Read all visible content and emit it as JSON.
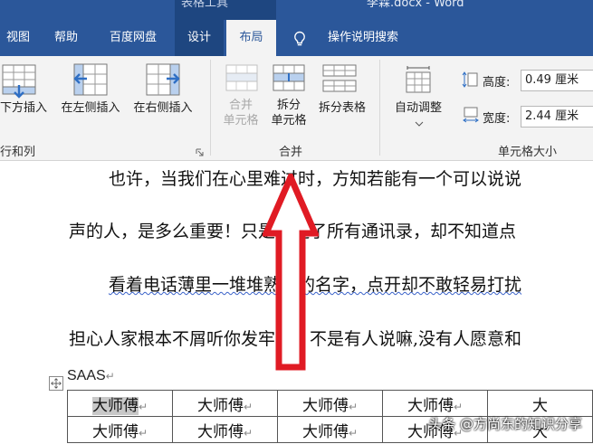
{
  "titlebar": {
    "tools_label": "表格工具",
    "document_title": "李霖.docx - Word"
  },
  "tabs": [
    {
      "label": "视图"
    },
    {
      "label": "帮助"
    },
    {
      "label": "百度网盘"
    },
    {
      "label": "设计"
    },
    {
      "label": "布局"
    },
    {
      "label": "操作说明搜索"
    }
  ],
  "ribbon": {
    "rows_cols": {
      "insert_below": "下方插入",
      "insert_left": "在左侧插入",
      "insert_right": "在右侧插入",
      "group_label": "行和列"
    },
    "merge": {
      "merge_cells_1": "合并",
      "merge_cells_2": "单元格",
      "split_cells_1": "拆分",
      "split_cells_2": "单元格",
      "split_table": "拆分表格",
      "group_label": "合并"
    },
    "cell_size": {
      "autofit": "自动调整",
      "height_label": "高度:",
      "height_value": "0.49 厘米",
      "width_label": "宽度:",
      "width_value": "2.44 厘米",
      "group_label": "单元格大小"
    }
  },
  "document": {
    "paragraphs": [
      "也许，当我们在心里难过时，方知若能有一个可以说说",
      "声的人，是多么重要！只是翻遍了所有通讯录，却不知道点",
      "看着电话薄里一堆堆熟悉的名字，点开却不敢轻易打扰",
      "担心人家根本不屑听你发牢骚。不是有人说嘛,没有人愿意和"
    ],
    "saas_label": "SAAS",
    "table_rows": [
      [
        "大师傅",
        "大师傅",
        "大师傅",
        "大师傅",
        "大"
      ],
      [
        "大师傅",
        "大师傅",
        "大师傅",
        "大师傅",
        "大"
      ]
    ]
  },
  "watermark": "头条 @方尚东的知识分享"
}
